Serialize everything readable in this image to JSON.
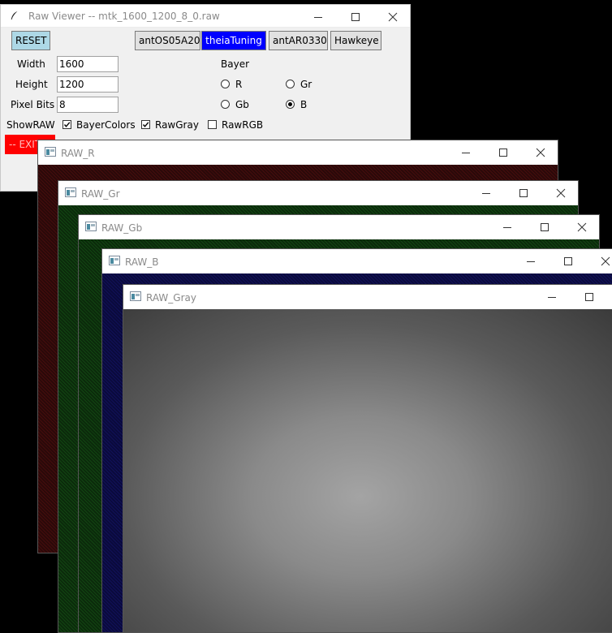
{
  "viewer": {
    "title": "Raw Viewer -- mtk_1600_1200_8_0.raw",
    "reset_label": "RESET",
    "exit_label": "-- EXIT --",
    "presets": [
      "antOS05A20",
      "theiaTuning",
      "antAR0330",
      "Hawkeye"
    ],
    "active_preset": "theiaTuning",
    "width_label": "Width",
    "width_value": "1600",
    "height_label": "Height",
    "height_value": "1200",
    "pixel_bits_label": "Pixel Bits",
    "pixel_bits_value": "8",
    "bayer_label": "Bayer",
    "bayer_options": [
      "R",
      "Gr",
      "Gb",
      "B"
    ],
    "bayer_selected": "B",
    "showraw_label": "ShowRAW",
    "checkboxes": [
      {
        "label": "BayerColors",
        "checked": true
      },
      {
        "label": "RawGray",
        "checked": true
      },
      {
        "label": "RawRGB",
        "checked": false
      }
    ]
  },
  "image_windows": [
    {
      "title": "RAW_R",
      "channel": "red"
    },
    {
      "title": "RAW_Gr",
      "channel": "green"
    },
    {
      "title": "RAW_Gb",
      "channel": "green"
    },
    {
      "title": "RAW_B",
      "channel": "blue"
    },
    {
      "title": "RAW_Gray",
      "channel": "gray"
    }
  ],
  "colors": {
    "reset_button": "#add8e6",
    "active_preset": "#0000ff",
    "exit_button": "#ff0000",
    "desktop": "#000000"
  }
}
